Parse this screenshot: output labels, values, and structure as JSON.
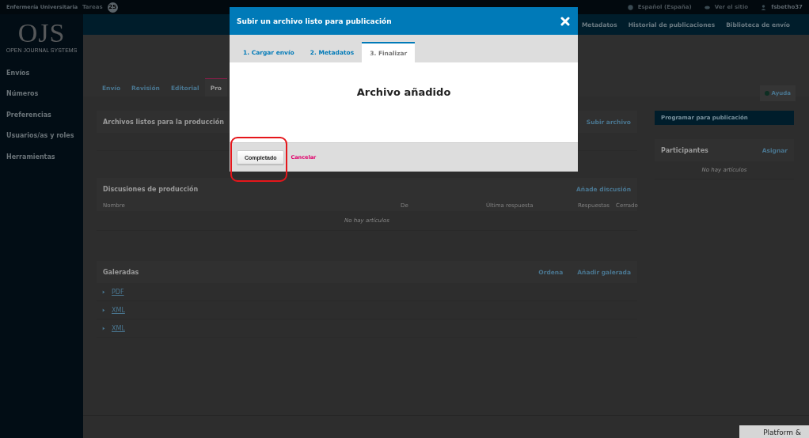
{
  "top_bar": {
    "site": "Enfermería Universitaria",
    "tasks_label": "Tareas",
    "tasks_count": "25",
    "language": "Español (España)",
    "view_site": "Ver el sitio",
    "user": "fsbetho37"
  },
  "sidebar": {
    "logo": "OJS",
    "logo_subtitle": "OPEN JOURNAL SYSTEMS",
    "items": [
      "Envíos",
      "Números",
      "Preferencias",
      "Usuarios/as y roles",
      "Herramientas"
    ]
  },
  "nav": {
    "items": [
      "Metadatos",
      "Historial de publicaciones",
      "Biblioteca de envío"
    ]
  },
  "tabs": [
    {
      "label": "Envío",
      "selected": false
    },
    {
      "label": "Revisión",
      "selected": false
    },
    {
      "label": "Editorial",
      "selected": false
    },
    {
      "label": "Pro",
      "selected": true
    }
  ],
  "help_button": "Ayuda",
  "files_panel": {
    "title": "Archivos listos para la producción",
    "action": "Subir archivo"
  },
  "discussions": {
    "title": "Discusiones de producción",
    "action": "Añade discusión",
    "columns": [
      "Nombre",
      "De",
      "Última respuesta",
      "Respuestas",
      "Cerrado"
    ],
    "empty": "No hay artículos"
  },
  "galleys": {
    "title": "Galeradas",
    "actions": [
      "Ordena",
      "Añadir galerada"
    ],
    "items": [
      "PDF",
      "XML",
      "XML"
    ]
  },
  "schedule_button": "Programar para publicación",
  "participants": {
    "title": "Participantes",
    "action": "Asignar",
    "empty": "No hay artículos"
  },
  "footer": {
    "text": "Platform &"
  },
  "modal": {
    "title": "Subir un archivo listo para publicación",
    "tabs": [
      {
        "label": "1. Cargar envío",
        "selected": false
      },
      {
        "label": "2. Metadatos",
        "selected": false
      },
      {
        "label": "3. Finalizar",
        "selected": true
      }
    ],
    "message": "Archivo añadido",
    "done_button": "Completado",
    "cancel_link": "Cancelar"
  }
}
